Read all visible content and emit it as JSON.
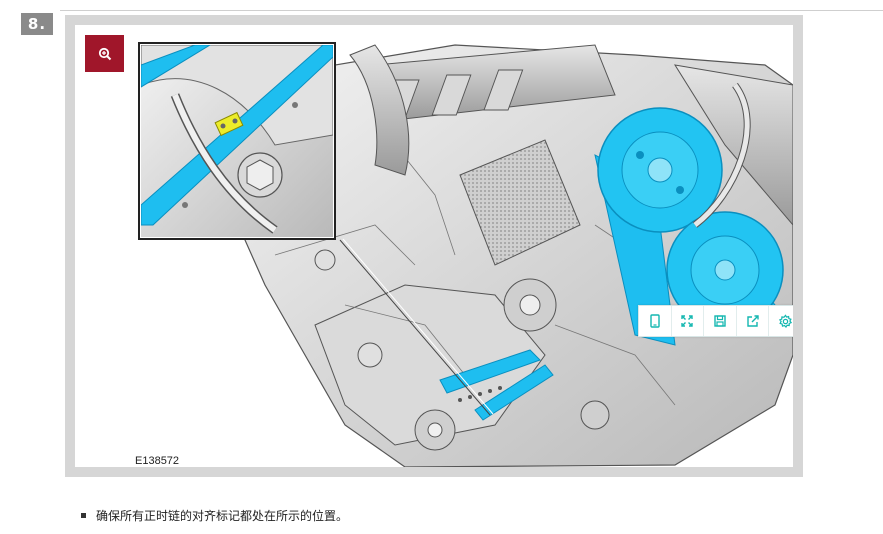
{
  "step": {
    "number": "8."
  },
  "figure": {
    "id_label": "E138572"
  },
  "toolbar": {
    "buttons": [
      {
        "icon": "tablet-icon"
      },
      {
        "icon": "expand-icon"
      },
      {
        "icon": "save-icon"
      },
      {
        "icon": "share-icon"
      },
      {
        "icon": "settings-gear-icon"
      }
    ]
  },
  "instructions": [
    {
      "text": "确保所有正时链的对齐标记都处在所示的位置。"
    }
  ],
  "colors": {
    "accent_teal": "#14b7b0",
    "zoom_button": "#a0162a",
    "highlight_blue": "#1ebef0",
    "badge_gray": "#8a8a8a"
  }
}
